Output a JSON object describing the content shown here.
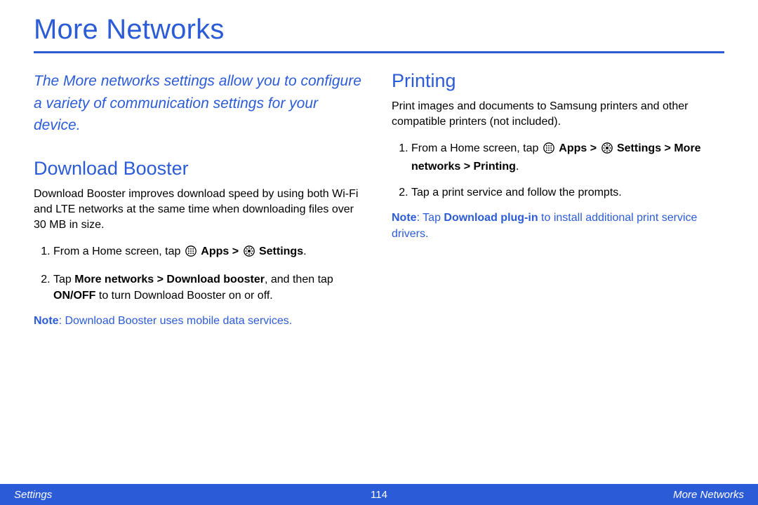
{
  "title": "More Networks",
  "intro": "The More networks settings allow you to configure a variety of communication settings for your device.",
  "left": {
    "section_title": "Download Booster",
    "body": "Download Booster improves download speed by using both Wi-Fi and LTE networks at the same time when downloading files over 30 MB in size.",
    "step1_a": "From a Home screen, tap ",
    "step1_apps": "Apps > ",
    "step1_settings": "Settings",
    "step1_end": ".",
    "step2_a": "Tap ",
    "step2_b1": "More networks > Download booster",
    "step2_b": ", and then tap ",
    "step2_b2": "ON/OFF",
    "step2_c": " to turn Download Booster on or off.",
    "note_label": "Note",
    "note_text": ": Download Booster uses mobile data services."
  },
  "right": {
    "section_title": "Printing",
    "body": "Print images and documents to Samsung printers and other compatible printers (not included).",
    "step1_a": "From a Home screen, tap ",
    "step1_apps": "Apps > ",
    "step1_settings": "Settings > More networks > Printing",
    "step1_end": ".",
    "step2": "Tap a print service and follow the prompts.",
    "note_label": "Note",
    "note_a": ": Tap ",
    "note_b": "Download plug-in",
    "note_c": " to install additional print service drivers."
  },
  "footer": {
    "left": "Settings",
    "center": "114",
    "right": "More Networks"
  }
}
